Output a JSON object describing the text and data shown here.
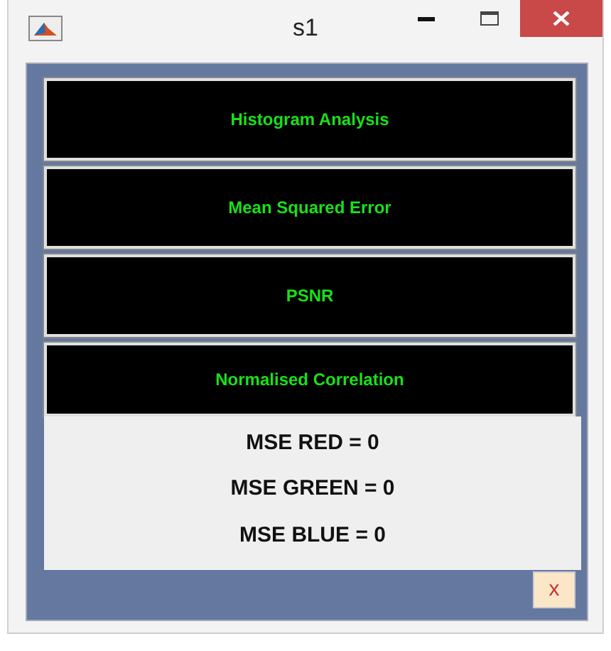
{
  "window": {
    "title": "s1"
  },
  "buttons": [
    {
      "label": "Histogram Analysis"
    },
    {
      "label": "Mean Squared Error"
    },
    {
      "label": "PSNR"
    },
    {
      "label": "Normalised Correlation"
    }
  ],
  "results": [
    "MSE RED = 0",
    "MSE GREEN = 0",
    "MSE BLUE = 0"
  ],
  "close_button": {
    "label": "x"
  }
}
